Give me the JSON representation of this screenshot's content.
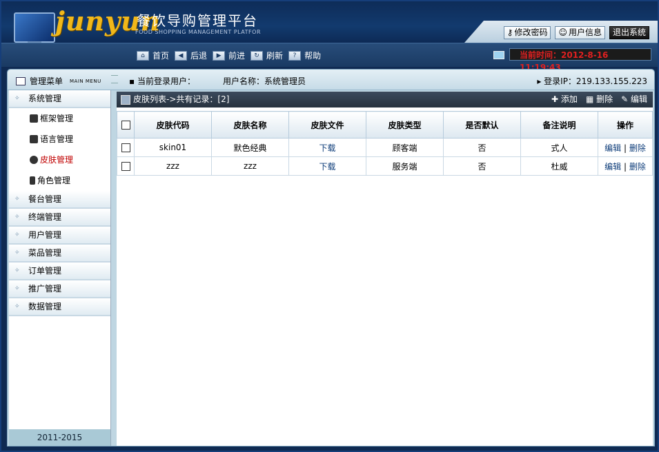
{
  "header": {
    "brand": "junyun",
    "title": "餐饮导购管理平台",
    "subtitle": "FOOD SHOPPING MANAGEMENT PLATFOR",
    "buttons": {
      "change_password": "修改密码",
      "user_info": "用户信息",
      "logout": "退出系统"
    }
  },
  "nav": {
    "home": "首页",
    "back": "后退",
    "forward": "前进",
    "refresh": "刷新",
    "help": "帮助",
    "help_icon": "?",
    "clock": "当前时间：2012-8-16 11:19:43"
  },
  "infobar": {
    "menu_title": "管理菜单",
    "menu_en": "MAIN MENU",
    "login_user": "当前登录用户：",
    "user_name": "用户名称：系统管理员",
    "login_ip": "登录IP：219.133.155.223"
  },
  "sidebar": {
    "system_group": "系统管理",
    "sub_items": [
      "框架管理",
      "语言管理",
      "皮肤管理",
      "角色管理"
    ],
    "active_sub": 2,
    "groups": [
      "餐台管理",
      "终端管理",
      "用户管理",
      "菜品管理",
      "订单管理",
      "推广管理",
      "数据管理"
    ],
    "footer": "2011-2015"
  },
  "panel": {
    "title": "皮肤列表->共有记录：[2]",
    "add": "添加",
    "delete": "删除",
    "edit": "编辑",
    "columns": [
      "皮肤代码",
      "皮肤名称",
      "皮肤文件",
      "皮肤类型",
      "是否默认",
      "备注说明",
      "操作"
    ],
    "rows": [
      {
        "code": "skin01",
        "name": "默色经典",
        "file": "下载",
        "type": "顾客端",
        "default": "否",
        "remark": "式人",
        "edit": "编辑",
        "sep": "|",
        "delete": "删除"
      },
      {
        "code": "zzz",
        "name": "zzz",
        "file": "下载",
        "type": "服务端",
        "default": "否",
        "remark": "杜威",
        "edit": "编辑",
        "sep": "|",
        "delete": "删除"
      }
    ]
  },
  "colors": {
    "header_bg": "#123a6e",
    "brand": "#f1b81a",
    "active": "#c00000",
    "clock": "#e02020"
  }
}
